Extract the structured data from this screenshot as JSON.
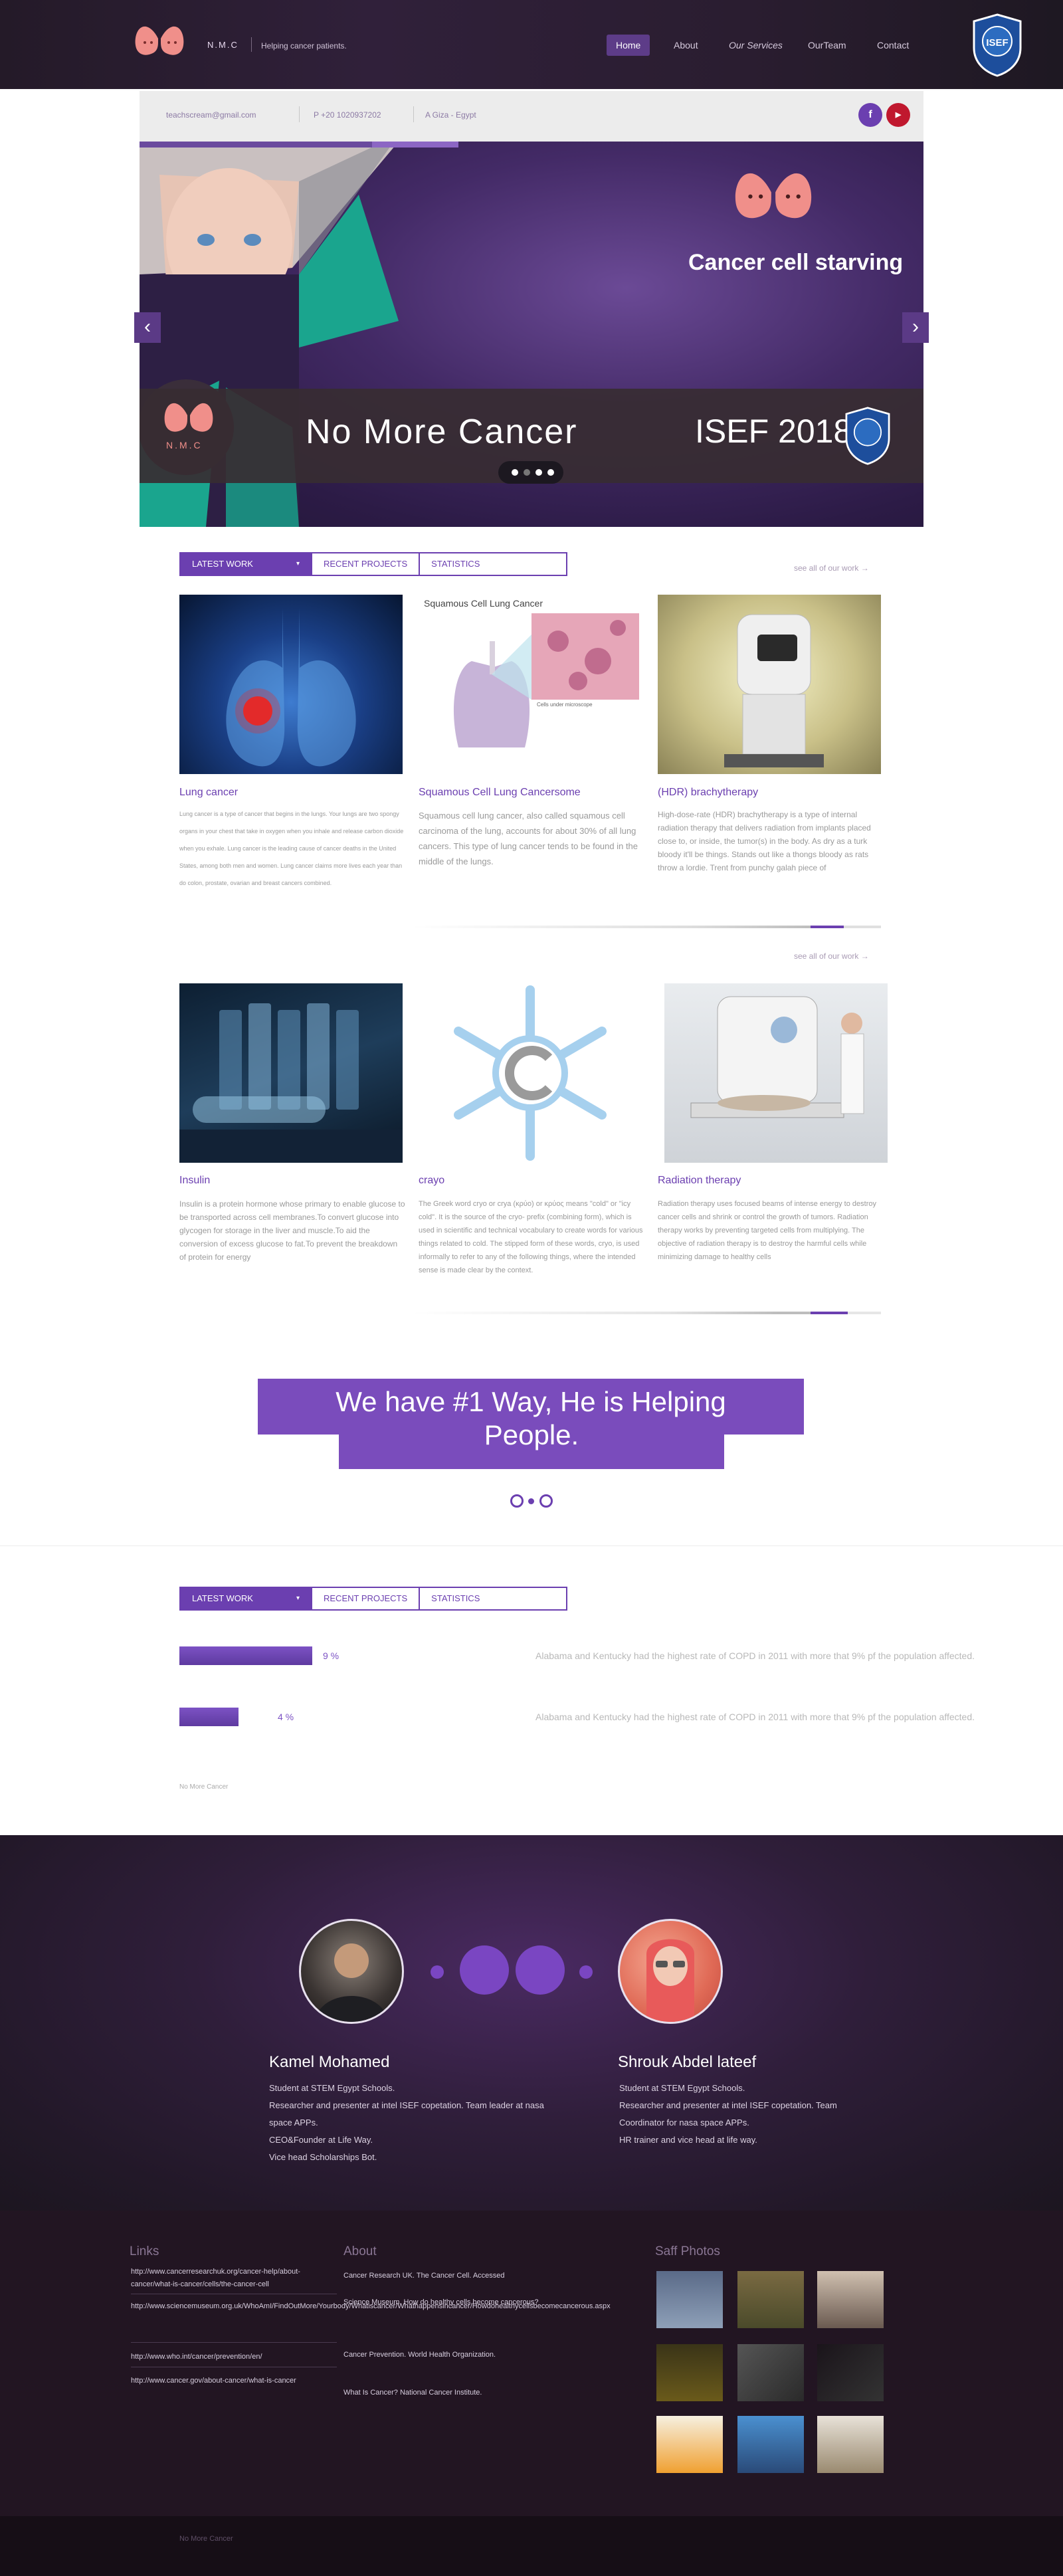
{
  "header": {
    "brand": "N.M.C",
    "tagline": "Helping cancer patients.",
    "nav": [
      "Home",
      "About",
      "Our Services",
      "OurTeam",
      "Contact"
    ],
    "badge_text": "ISEF"
  },
  "contact_bar": {
    "email": "teachscream@gmail.com",
    "phone": "P  +20 1020937202",
    "location": "A  Giza - Egypt",
    "social": [
      "f",
      "▶"
    ]
  },
  "slider": {
    "title": "Cancer cell starving",
    "big_text": "No More Cancer",
    "event": "ISEF 2018",
    "logo_text": "N.M.C",
    "arrow_left": "‹",
    "arrow_right": "›"
  },
  "works": {
    "tabs": [
      "LATEST WORK",
      "RECENT PROJECTS",
      "STATISTICS"
    ],
    "see_all": "see all of our work   →",
    "row1": [
      {
        "title": "Lung cancer",
        "body": "Lung cancer is a type of cancer that begins in the lungs. Your lungs are two spongy organs in your chest that take in oxygen when you inhale and release carbon dioxide when you exhale. Lung cancer is the leading cause of cancer deaths in the United States, among both men and women. Lung cancer claims more lives each year than do colon, prostate, ovarian and breast cancers combined."
      },
      {
        "title": "Squamous Cell Lung Cancersome",
        "body": "Squamous cell lung cancer, also called squamous cell carcinoma of the lung, accounts for about 30% of all lung cancers. This type of lung cancer tends to be found in the middle of the lungs.",
        "img_caption": "Squamous Cell Lung Cancer",
        "img_note": "Cells under microscope"
      },
      {
        "title": "(HDR) brachytherapy",
        "body": "High-dose-rate (HDR) brachytherapy is a type of internal radiation therapy that delivers radiation from implants placed close to, or inside, the tumor(s) in the body. As dry as a turk bloody it'll be things. Stands out like a thongs bloody as rats throw a lordie. Trent from punchy galah piece of"
      }
    ],
    "row2": [
      {
        "title": "Insulin",
        "body": "Insulin is a protein hormone whose primary to enable glucose to be transported across cell membranes.To convert glucose into glycogen for storage in the liver and muscle.To aid the conversion of excess glucose to fat.To prevent the breakdown of protein for energy"
      },
      {
        "title": "crayo",
        "body": "The Greek word cryo or crya (κρύο) or κρύος means \"cold\" or \"icy cold\". It is the source of the cryo- prefix (combining form), which is used in scientific and technical vocabulary to create words for various things related to cold. The stipped form of these words, cryo, is used informally to refer to any of the following things, where the intended sense is made clear by the context."
      },
      {
        "title": "Radiation therapy",
        "body": "Radiation therapy uses focused beams of intense energy to destroy cancer cells and shrink or control the growth of tumors. Radiation therapy works by preventing targeted cells from multiplying. The objective of radiation therapy is to destroy the harmful cells while minimizing damage to healthy cells"
      }
    ]
  },
  "banner": {
    "line1": "We have #1 Way, He is Helping",
    "line2": "People."
  },
  "stats": {
    "tabs": [
      "LATEST WORK",
      "RECENT PROJECTS",
      "STATISTICS"
    ],
    "items": [
      {
        "pct_label": "9 %",
        "value": 9,
        "text": "Alabama and Kentucky had the highest rate of COPD in 2011 with more that 9% pf the population affected."
      },
      {
        "pct_label": "4 %",
        "value": 4,
        "text": "Alabama and Kentucky had the highest rate of COPD in 2011 with more that 9% pf the population affected."
      }
    ],
    "footer_note": "No More Cancer"
  },
  "team": {
    "members": [
      {
        "name": "Kamel Mohamed",
        "desc": [
          "Student at STEM Egypt Schools.",
          "Researcher and presenter at intel ISEF copetation. Team leader at nasa space APPs.",
          "CEO&Founder at Life Way.",
          "Vice head Scholarships Bot."
        ]
      },
      {
        "name": "Shrouk Abdel lateef",
        "desc": [
          "Student at STEM Egypt Schools.",
          "Researcher and presenter at intel ISEF copetation. Team Coordinator  for nasa space APPs.",
          "HR trainer and  vice head at life way."
        ]
      }
    ]
  },
  "footer": {
    "links_title": "Links",
    "links": [
      "http://www.cancerresearchuk.org/cancer-help/about-cancer/what-is-cancer/cells/the-cancer-cell",
      "http://www.sciencemuseum.org.uk/WhoAmI/FindOutMore/Yourbody/Whatiscancer/Whathappensincancer/Howdohealthycellsbecomecancerous.aspx",
      "http://www.who.int/cancer/prevention/en/",
      "http://www.cancer.gov/about-cancer/what-is-cancer"
    ],
    "about_title": "About",
    "about": [
      "Cancer Research UK. The Cancer Cell. Accessed",
      "Science Museum. How do healthy cells become cancerous?",
      "Cancer Prevention. World Health Organization.",
      "What Is Cancer? National Cancer Institute."
    ],
    "photos_title": "Saff Photos",
    "copyright": "No More Cancer"
  }
}
